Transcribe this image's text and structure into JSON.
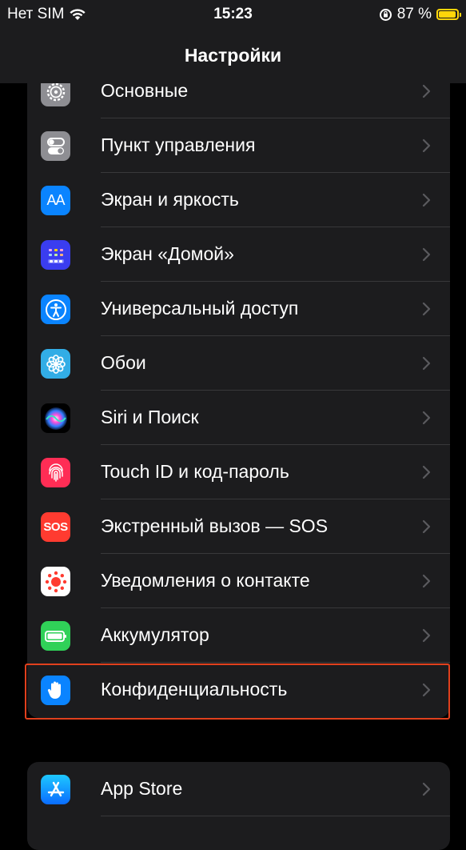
{
  "status": {
    "carrier": "Нет SIM",
    "time": "15:23",
    "battery_pct": "87 %",
    "battery_level": 0.87
  },
  "nav": {
    "title": "Настройки"
  },
  "settings": [
    {
      "label": "Основные",
      "icon": "gear-icon",
      "color": "#8e8e93"
    },
    {
      "label": "Пункт управления",
      "icon": "control-center-icon",
      "color": "#8e8e93"
    },
    {
      "label": "Экран и яркость",
      "icon": "display-brightness-icon",
      "color": "#0a84ff"
    },
    {
      "label": "Экран «Домой»",
      "icon": "home-screen-icon",
      "color": "#3a3df0"
    },
    {
      "label": "Универсальный доступ",
      "icon": "accessibility-icon",
      "color": "#0a84ff"
    },
    {
      "label": "Обои",
      "icon": "wallpaper-flower-icon",
      "color": "#32ade6"
    },
    {
      "label": "Siri и Поиск",
      "icon": "siri-icon",
      "color": "#1c1c1e"
    },
    {
      "label": "Touch ID и код-пароль",
      "icon": "fingerprint-icon",
      "color": "#ff2d55"
    },
    {
      "label": "Экстренный вызов — SOS",
      "icon": "sos-icon",
      "color": "#ff3b30",
      "icon_text": "SOS"
    },
    {
      "label": "Уведомления о контакте",
      "icon": "exposure-notification-icon",
      "color": "#ffffff"
    },
    {
      "label": "Аккумулятор",
      "icon": "battery-icon",
      "color": "#30d158"
    },
    {
      "label": "Конфиденциальность",
      "icon": "privacy-hand-icon",
      "color": "#0a84ff"
    }
  ],
  "settings2": [
    {
      "label": "App Store",
      "icon": "app-store-icon",
      "color": "#0a84ff"
    }
  ]
}
